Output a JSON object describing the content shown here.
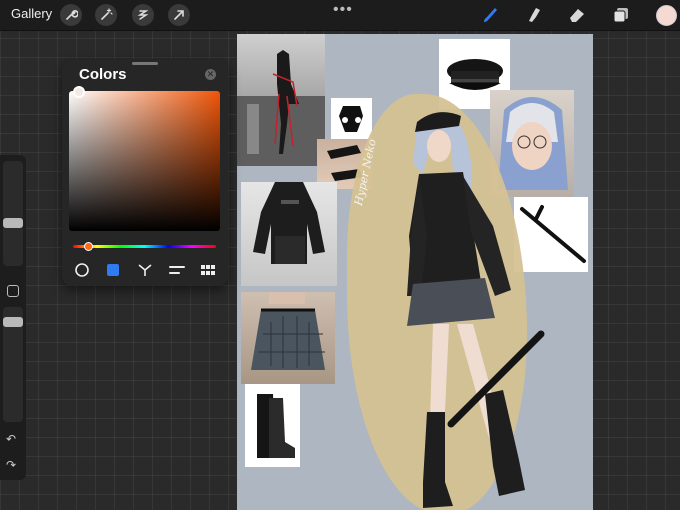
{
  "topbar": {
    "gallery_label": "Gallery",
    "icons": [
      "wrench-icon",
      "magic-wand-icon",
      "selection-icon",
      "transform-arrow-icon"
    ],
    "more": "•••",
    "tools": [
      "brush-icon",
      "smudge-icon",
      "eraser-icon",
      "layers-icon"
    ],
    "current_color": "#f5d9d2",
    "active_tool_color": "#2f7bf0"
  },
  "colors_panel": {
    "title": "Colors",
    "close": "✕",
    "field_hue_color": "#ef5508",
    "selected_color": "#f3e9e4",
    "modes": [
      "disc-mode",
      "classic-mode",
      "harmony-mode",
      "value-mode",
      "palettes-mode"
    ],
    "active_mode": "classic-mode"
  },
  "sidebar": {
    "undo": "↶",
    "redo": "↷"
  },
  "canvas": {
    "background": "#adb6c1",
    "signature": "Hyper Neko",
    "items": [
      "runway-photo",
      "harness-photo",
      "gloves-photo",
      "outfit-photo",
      "skirt-photo",
      "boots-photo",
      "cap-photo",
      "portrait-photo",
      "baton-photo"
    ]
  }
}
